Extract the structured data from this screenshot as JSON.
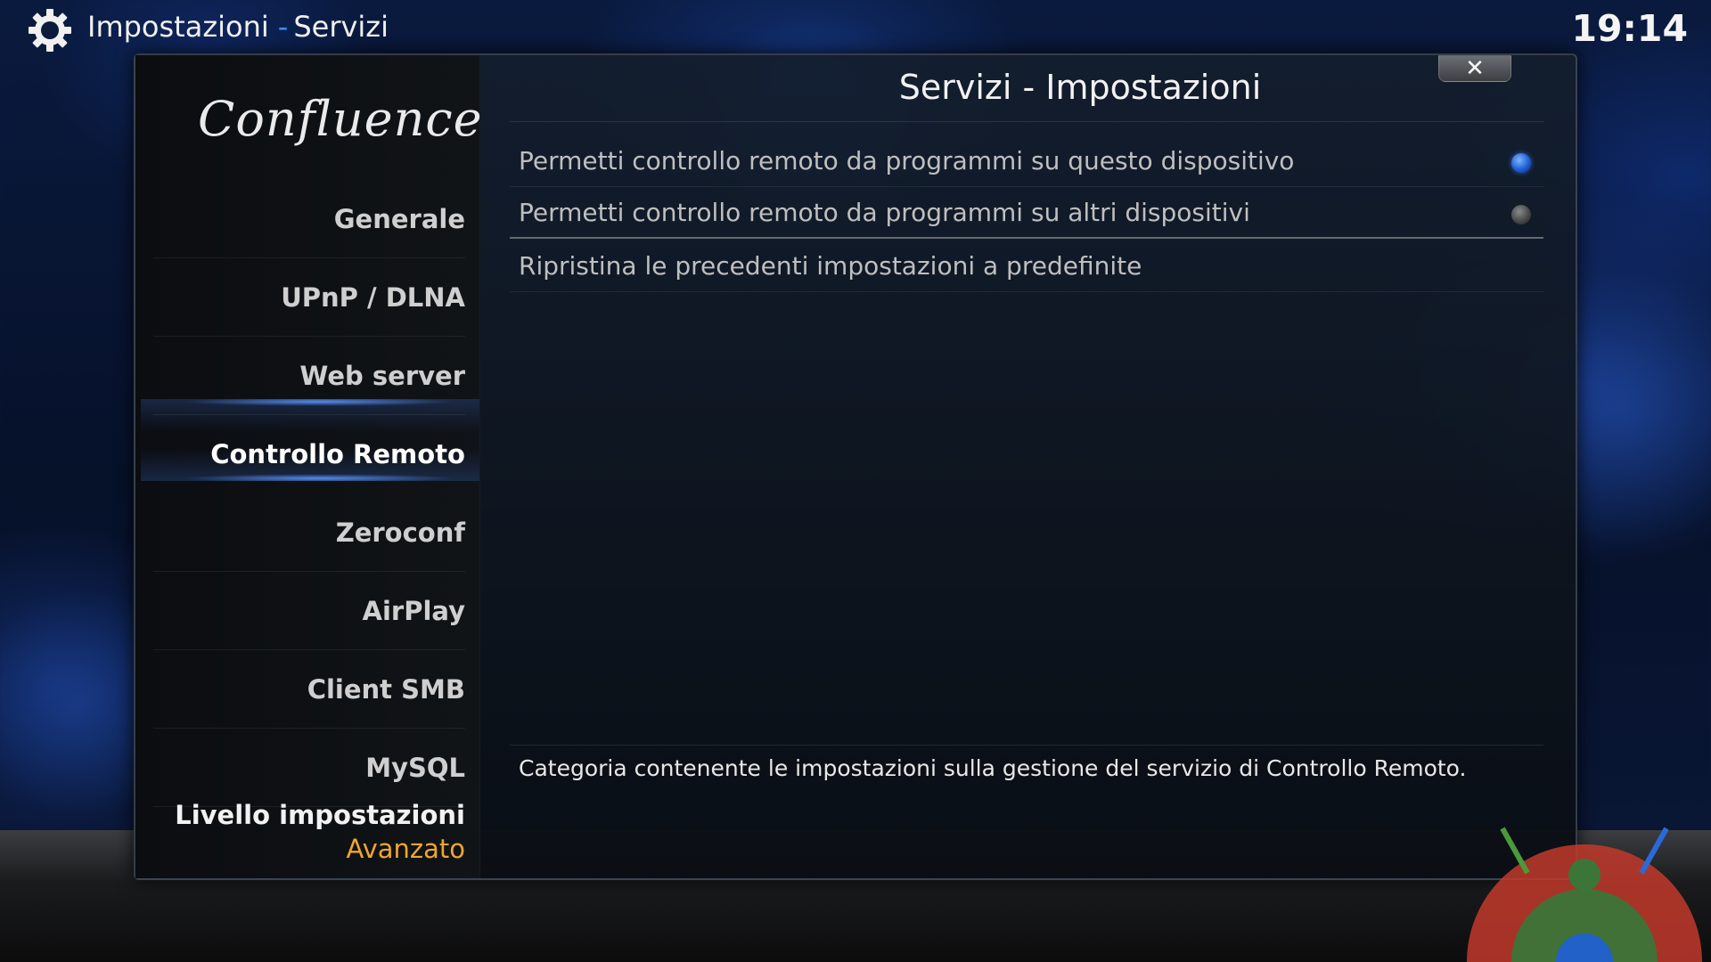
{
  "header": {
    "section": "Impostazioni",
    "separator": "-",
    "subsection": "Servizi",
    "clock": "19:14"
  },
  "dialog": {
    "logo": "Confluence",
    "title": "Servizi - Impostazioni",
    "close_label": "✕",
    "sidebar": {
      "items": [
        {
          "label": "Generale"
        },
        {
          "label": "UPnP / DLNA"
        },
        {
          "label": "Web server"
        },
        {
          "label": "Controllo Remoto"
        },
        {
          "label": "Zeroconf"
        },
        {
          "label": "AirPlay"
        },
        {
          "label": "Client SMB"
        },
        {
          "label": "MySQL"
        }
      ],
      "active_item": "Controllo Remoto",
      "level_label": "Livello impostazioni",
      "level_value": "Avanzato"
    },
    "settings": [
      {
        "label": "Permetti controllo remoto da programmi su questo dispositivo",
        "enabled": true
      },
      {
        "label": "Permetti controllo remoto da programmi su altri dispositivi",
        "enabled": false
      },
      {
        "label": "Ripristina le precedenti impostazioni a predefinite"
      }
    ],
    "description": "Categoria contenente le impostazioni sulla gestione del servizio di Controllo Remoto."
  },
  "colors": {
    "accent": "#3a8cff",
    "level_value": "#f0a530",
    "radio_on": "#1e5fd8"
  },
  "icons": [
    "gear-icon",
    "close-icon",
    "radio-on-icon",
    "radio-off-icon"
  ]
}
